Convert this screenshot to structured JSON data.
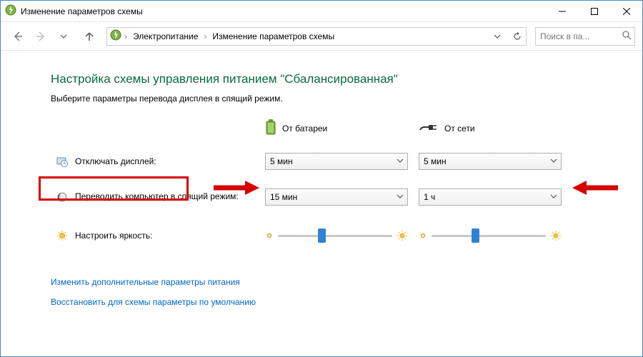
{
  "titlebar": {
    "title": "Изменение параметров схемы"
  },
  "navbar": {
    "crumb1": "Электропитание",
    "crumb2": "Изменение параметров схемы",
    "search_placeholder": "Поиск в па..."
  },
  "content": {
    "heading": "Настройка схемы управления питанием \"Сбалансированная\"",
    "subtext": "Выберите параметры перевода дисплея в спящий режим.",
    "col_battery": "От батареи",
    "col_ac": "От сети",
    "row_display": "Отключать дисплей:",
    "row_sleep": "Переводить компьютер в спящий режим:",
    "row_brightness": "Настроить яркость:",
    "display_battery": "5 мин",
    "display_ac": "5 мин",
    "sleep_battery": "15 мин",
    "sleep_ac": "1 ч"
  },
  "links": {
    "advanced": "Изменить дополнительные параметры питания",
    "restore": "Восстановить для схемы параметры по умолчанию"
  }
}
